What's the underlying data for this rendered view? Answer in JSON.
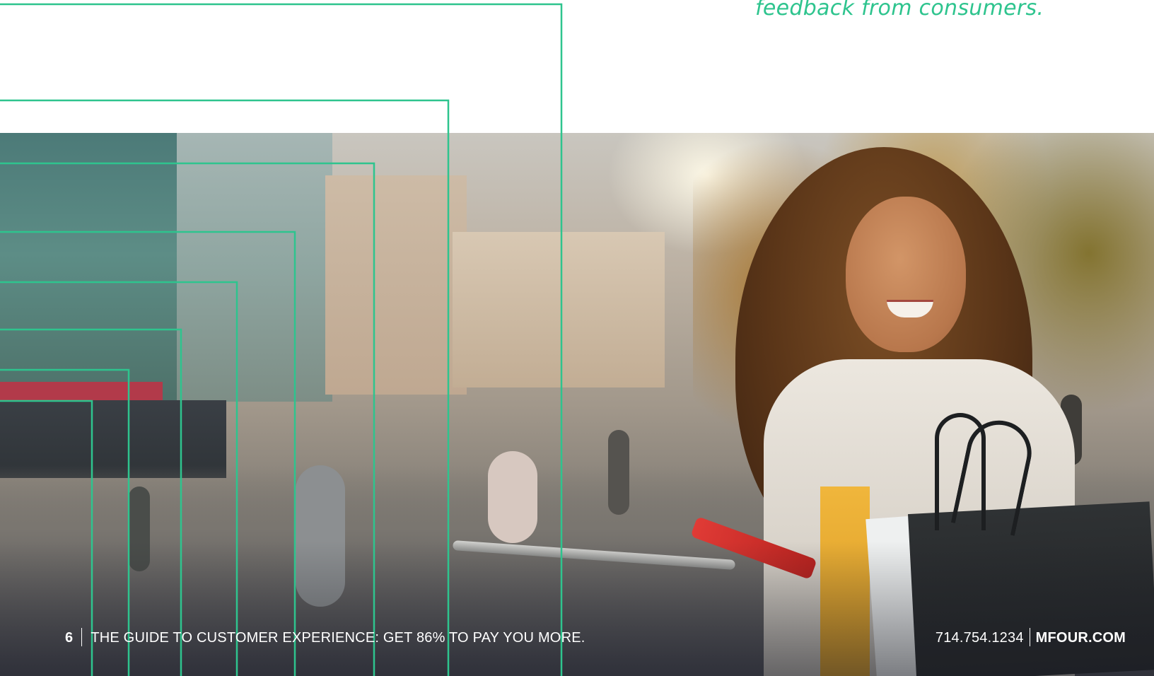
{
  "quote": {
    "text": "feedback from consumers."
  },
  "footer": {
    "page_number": "6",
    "guide_title": "THE GUIDE TO CUSTOMER EXPERIENCE: GET 86% TO PAY YOU MORE.",
    "phone": "714.754.1234",
    "website": "MFOUR.COM"
  },
  "colors": {
    "accent": "#2ec48e",
    "text_white": "#ffffff"
  },
  "photo": {
    "subject": "smiling woman with curly hair holding shopping bags and a red phone on a city street"
  }
}
